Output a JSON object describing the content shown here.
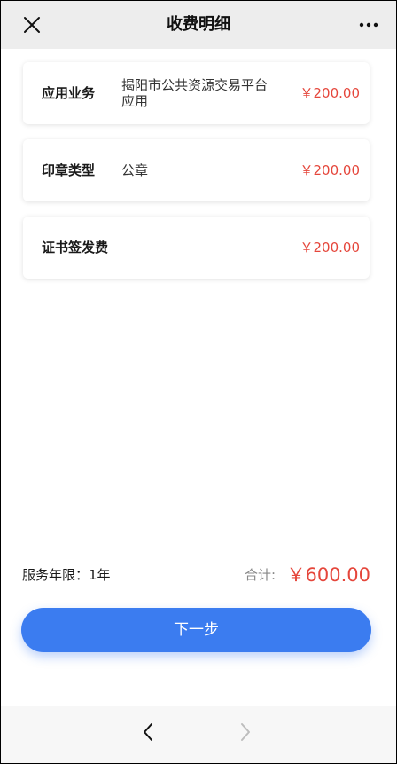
{
  "header": {
    "title": "收费明细",
    "close_icon": "close-icon",
    "more_icon": "more-dots-icon"
  },
  "items": [
    {
      "label": "应用业务",
      "value": "揭阳市公共资源交易平台应用",
      "price": "￥200.00"
    },
    {
      "label": "印章类型",
      "value": "公章",
      "price": "￥200.00"
    },
    {
      "label": "证书签发费",
      "value": "",
      "price": "￥200.00"
    }
  ],
  "summary": {
    "service_period": "服务年限：1年",
    "total_label": "合计:",
    "total_amount": "￥600.00"
  },
  "actions": {
    "next_label": "下一步"
  },
  "nav": {
    "back_icon": "chevron-left-icon",
    "forward_icon": "chevron-right-icon"
  },
  "colors": {
    "accent": "#3b7cf0",
    "price": "#e5463b",
    "header_bg": "#ededed"
  }
}
